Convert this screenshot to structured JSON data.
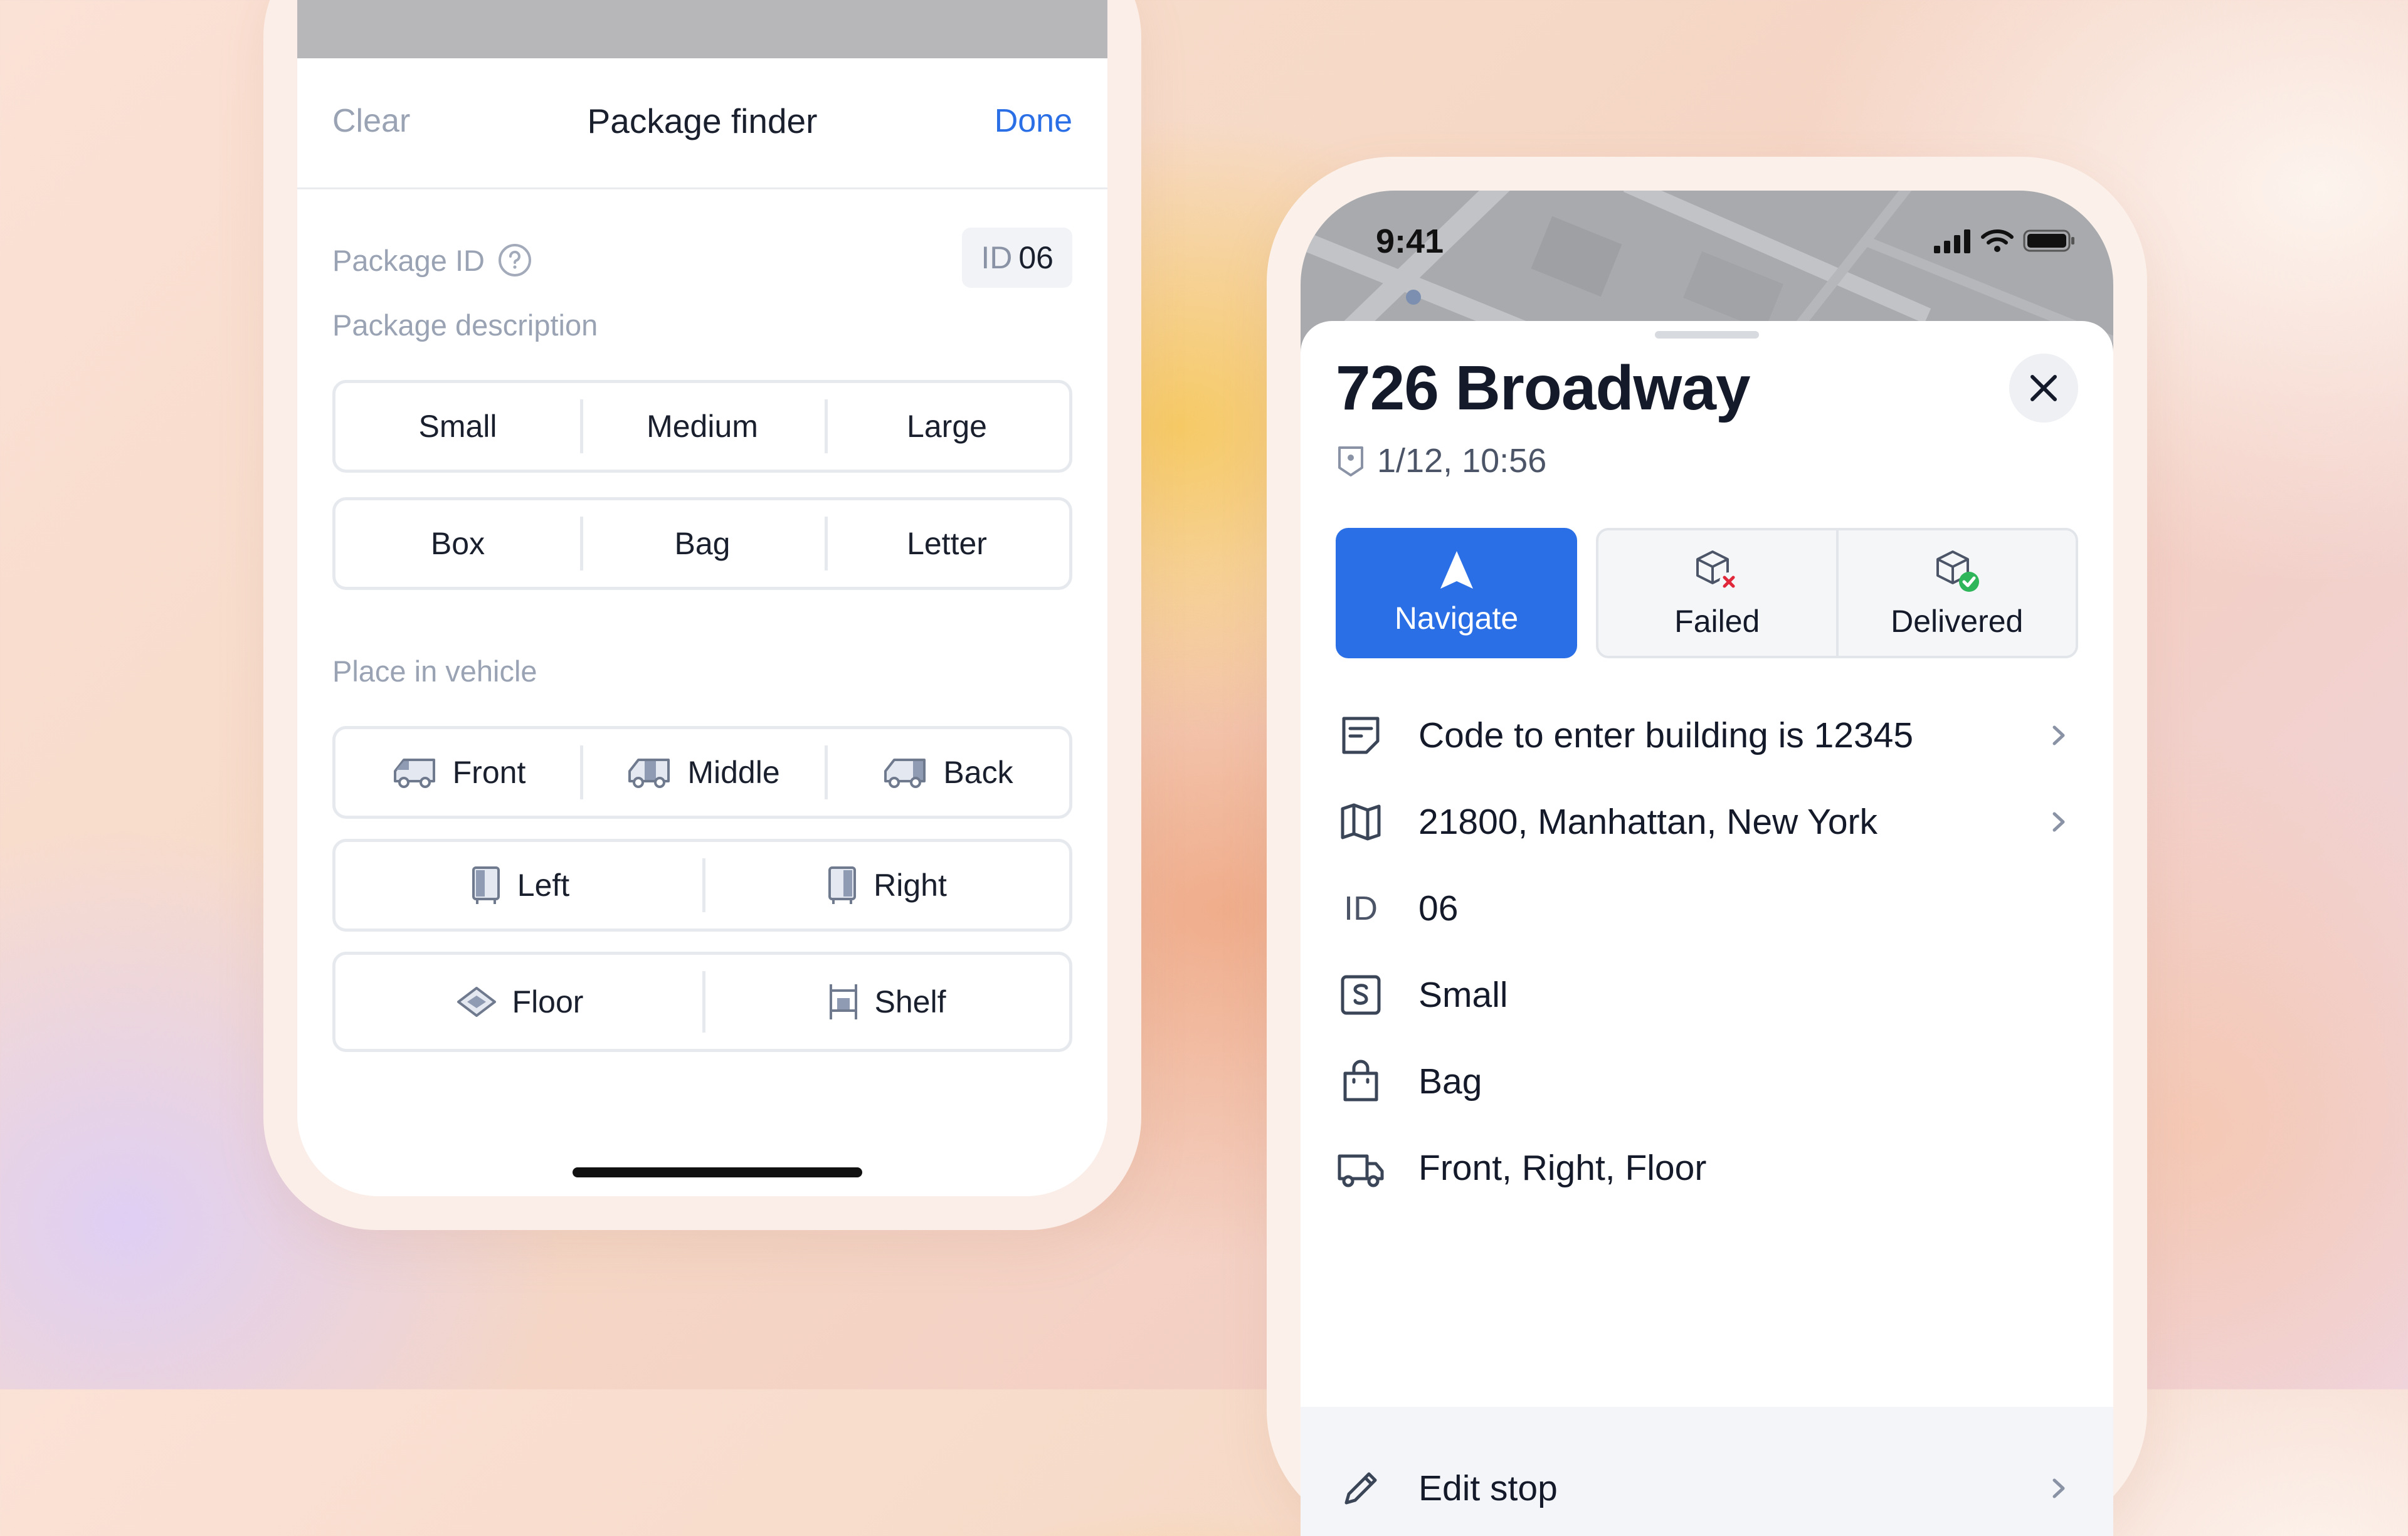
{
  "finder": {
    "clear_label": "Clear",
    "title": "Package finder",
    "done_label": "Done",
    "package_id_label": "Package ID",
    "package_id_prefix": "ID",
    "package_id_value": "06",
    "description_label": "Package description",
    "size_options": [
      "Small",
      "Medium",
      "Large"
    ],
    "type_options": [
      "Box",
      "Bag",
      "Letter"
    ],
    "place_label": "Place in vehicle",
    "position_options": [
      "Front",
      "Middle",
      "Back"
    ],
    "side_options": [
      "Left",
      "Right"
    ],
    "level_options": [
      "Floor",
      "Shelf"
    ]
  },
  "stop": {
    "status_time": "9:41",
    "address": "726 Broadway",
    "timestamp": "1/12, 10:56",
    "navigate_label": "Navigate",
    "failed_label": "Failed",
    "delivered_label": "Delivered",
    "note": "Code to enter building is 12345",
    "location": "21800, Manhattan, New York",
    "id_label": "ID",
    "id_value": "06",
    "size": "Small",
    "type": "Bag",
    "placement": "Front, Right, Floor",
    "edit_label": "Edit stop"
  },
  "colors": {
    "accent": "#2b6fe6",
    "failed": "#e0283a",
    "delivered": "#2fb55a"
  }
}
